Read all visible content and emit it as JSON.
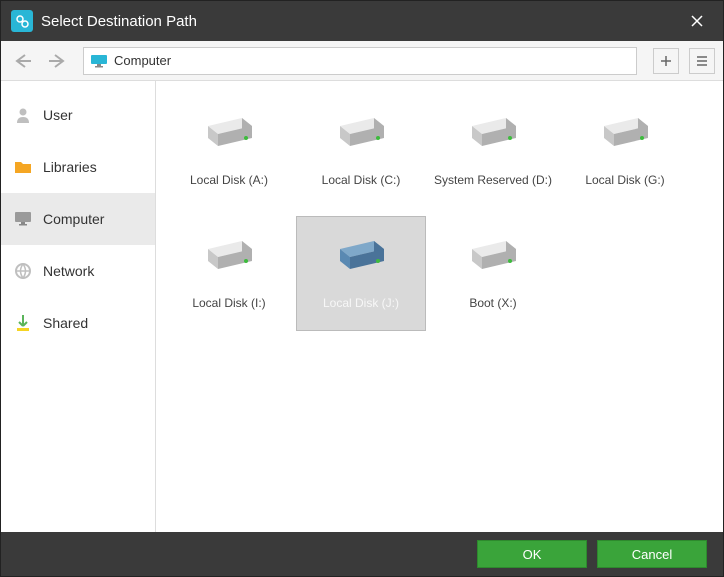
{
  "title": "Select Destination Path",
  "path_label": "Computer",
  "sidebar": [
    {
      "label": "User",
      "icon": "user-icon",
      "sel": false,
      "color": "#bfbfbf"
    },
    {
      "label": "Libraries",
      "icon": "folder-icon",
      "sel": false,
      "color": "#f5a623"
    },
    {
      "label": "Computer",
      "icon": "computer-icon",
      "sel": true,
      "color": "#9a9a9a"
    },
    {
      "label": "Network",
      "icon": "network-icon",
      "sel": false,
      "color": "#bfbfbf"
    },
    {
      "label": "Shared",
      "icon": "shared-icon",
      "sel": false,
      "color": "#f5d423"
    }
  ],
  "drives": [
    {
      "label": "Local Disk (A:)",
      "sel": false
    },
    {
      "label": "Local Disk (C:)",
      "sel": false
    },
    {
      "label": "System Reserved (D:)",
      "sel": false
    },
    {
      "label": "Local Disk (G:)",
      "sel": false
    },
    {
      "label": "Local Disk (I:)",
      "sel": false
    },
    {
      "label": "Local Disk (J:)",
      "sel": true
    },
    {
      "label": "Boot (X:)",
      "sel": false
    }
  ],
  "buttons": {
    "ok": "OK",
    "cancel": "Cancel"
  }
}
